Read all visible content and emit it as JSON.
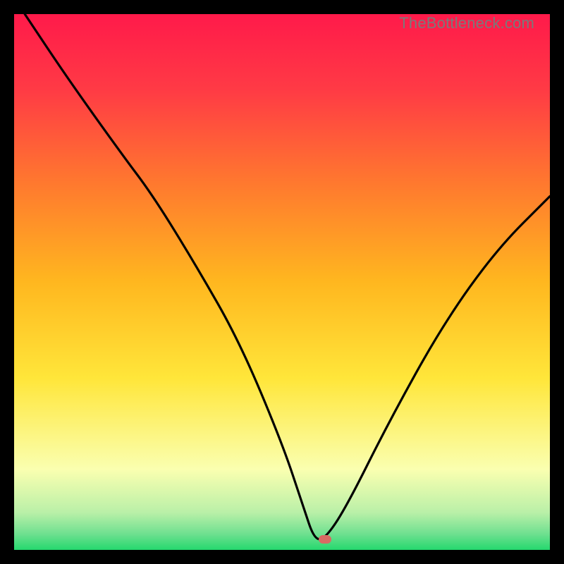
{
  "watermark": "TheBottleneck.com",
  "colors": {
    "bg_black": "#000000",
    "grad_top": "#ff1a4a",
    "grad_mid1": "#ff5a3a",
    "grad_mid2": "#ffa321",
    "grad_mid3": "#ffe63a",
    "grad_low": "#f8ffab",
    "grad_green1": "#9af09a",
    "grad_green2": "#25d86e",
    "curve": "#000000",
    "marker": "#d86a63"
  },
  "chart_data": {
    "type": "line",
    "title": "",
    "xlabel": "",
    "ylabel": "",
    "xlim": [
      0,
      100
    ],
    "ylim": [
      0,
      100
    ],
    "grid": false,
    "legend": false,
    "annotations": [
      {
        "kind": "marker",
        "x": 58,
        "y": 2,
        "shape": "pill",
        "color": "#d86a63"
      }
    ],
    "series": [
      {
        "name": "bottleneck-curve",
        "x": [
          2,
          10,
          20,
          26,
          34,
          42,
          50,
          54,
          56,
          58,
          62,
          70,
          80,
          90,
          100
        ],
        "y": [
          100,
          88,
          74,
          66,
          53,
          39,
          20,
          8,
          2,
          2,
          8,
          24,
          42,
          56,
          66
        ]
      }
    ],
    "gradient_stops": [
      {
        "pct": 0,
        "color": "#ff1a4a"
      },
      {
        "pct": 14,
        "color": "#ff3a45"
      },
      {
        "pct": 32,
        "color": "#ff7a2e"
      },
      {
        "pct": 50,
        "color": "#ffb71f"
      },
      {
        "pct": 68,
        "color": "#ffe63a"
      },
      {
        "pct": 85,
        "color": "#faffb0"
      },
      {
        "pct": 93,
        "color": "#baf0a8"
      },
      {
        "pct": 97,
        "color": "#6fe090"
      },
      {
        "pct": 100,
        "color": "#25d86e"
      }
    ]
  }
}
